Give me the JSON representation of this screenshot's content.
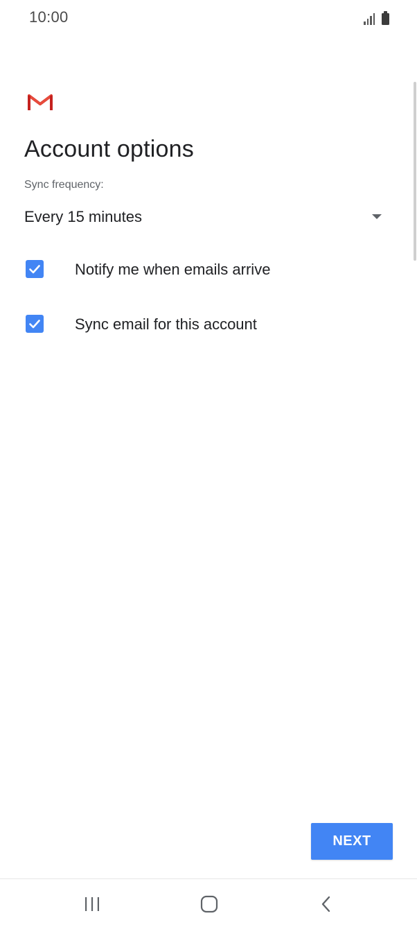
{
  "status_bar": {
    "time": "10:00",
    "icons": [
      "signal-icon",
      "battery-icon"
    ]
  },
  "app": {
    "logo": "gmail-logo-icon",
    "brand_colors": {
      "gmail_red": "#d93025",
      "accent_blue": "#4285f4"
    }
  },
  "page": {
    "title": "Account options",
    "sync_label": "Sync frequency:",
    "sync_value": "Every 15 minutes",
    "options": [
      {
        "label": "Notify me when emails arrive",
        "checked": true
      },
      {
        "label": "Sync email for this account",
        "checked": true
      }
    ],
    "next_label": "NEXT"
  },
  "nav_bar": {
    "buttons": [
      "recent-apps-icon",
      "home-icon",
      "back-icon"
    ]
  }
}
